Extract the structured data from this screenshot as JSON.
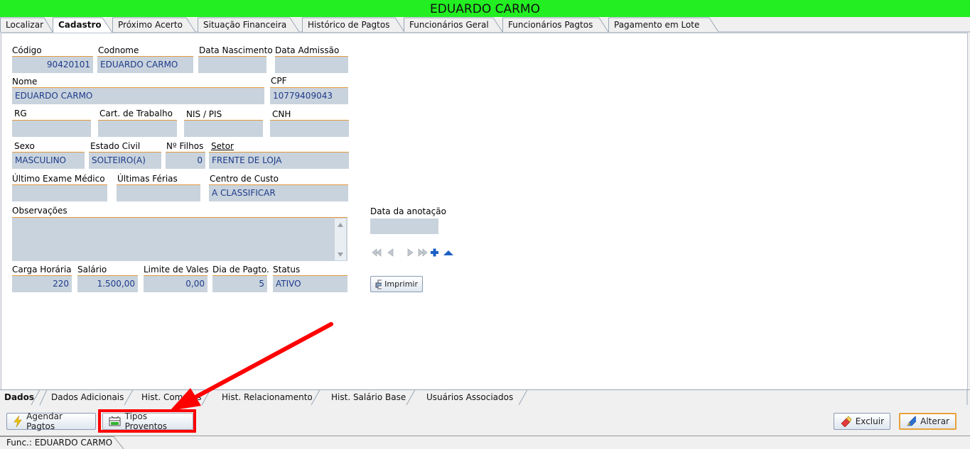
{
  "title": "EDUARDO CARMO",
  "tabs": [
    "Localizar",
    "Cadastro",
    "Próximo Acerto",
    "Situação Financeira",
    "Histórico de Pagtos",
    "Funcionários Geral",
    "Funcionários Pagtos",
    "Pagamento em Lote"
  ],
  "form": {
    "codigo_label": "Código",
    "codigo": "90420101",
    "codnome_label": "Codnome",
    "codnome": "EDUARDO CARMO",
    "nasc_label": "Data Nascimento",
    "nasc": "",
    "admissao_label": "Data Admissão",
    "admissao": "",
    "nome_label": "Nome",
    "nome": "EDUARDO CARMO",
    "cpf_label": "CPF",
    "cpf": "10779409043",
    "rg_label": "RG",
    "rg": "",
    "ctps_label": "Cart. de Trabalho",
    "ctps": "",
    "nis_label": "NIS / PIS",
    "nis": "",
    "cnh_label": "CNH",
    "cnh": "",
    "sexo_label": "Sexo",
    "sexo": "MASCULINO",
    "civil_label": "Estado Civil",
    "civil": "SOLTEIRO(A)",
    "filhos_label": "Nº Filhos",
    "filhos": "0",
    "setor_label": "Setor",
    "setor": "FRENTE DE LOJA",
    "exame_label": "Último Exame Médico",
    "exame": "",
    "ferias_label": "Últimas Férias",
    "ferias": "",
    "centro_label": "Centro de Custo",
    "centro": "A CLASSIFICAR",
    "obs_label": "Observações",
    "obs": "",
    "carga_label": "Carga Horária",
    "carga": "220",
    "salario_label": "Salário",
    "salario": "1.500,00",
    "vales_label": "Limite de Vales",
    "vales": "0,00",
    "diapag_label": "Dia de Pagto.",
    "diapag": "5",
    "status_label": "Status",
    "status": "ATIVO",
    "anot_label": "Data da anotação",
    "anot": "",
    "imprimir": "Imprimir"
  },
  "bottom_tabs": [
    "Dados",
    "Dados Adicionais",
    "Hist. Compras",
    "Hist. Relacionamento",
    "Hist. Salário Base",
    "Usuários Associados"
  ],
  "buttons": {
    "agendar": "Agendar Pagtos",
    "tipos": "Tipos Proventos",
    "excluir": "Excluir",
    "alterar": "Alterar"
  },
  "status_text": "Func.: EDUARDO CARMO",
  "colors": {
    "title_bg": "#22ee22",
    "field_bg": "#c9d3dd",
    "field_border": "#e59b3d",
    "highlight": "#ff0000"
  }
}
